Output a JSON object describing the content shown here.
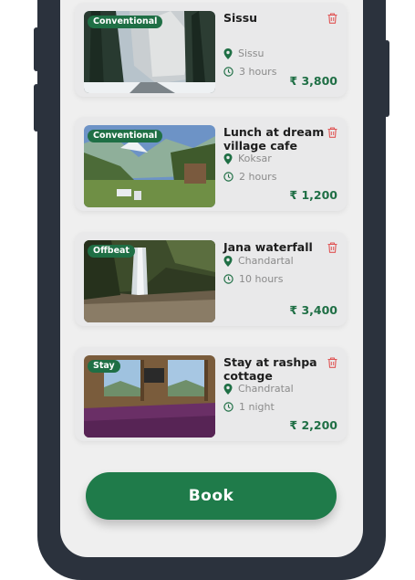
{
  "trips": [
    {
      "badge": "Conventional",
      "title": "Sissu",
      "location": "Sissu",
      "duration": "3 hours",
      "price": "₹ 3,800"
    },
    {
      "badge": "Conventional",
      "title": "Lunch at dream village cafe",
      "location": "Koksar",
      "duration": "2 hours",
      "price": "₹ 1,200"
    },
    {
      "badge": "Offbeat",
      "title": "Jana waterfall",
      "location": "Chandartal",
      "duration": "10 hours",
      "price": "₹ 3,400"
    },
    {
      "badge": "Stay",
      "title": "Stay at rashpa cottage",
      "location": "Chandratal",
      "duration": "1 night",
      "price": "₹ 2,200"
    }
  ],
  "book_button": {
    "label": "Book"
  },
  "icons": {
    "delete": "trash-icon",
    "location": "map-pin-icon",
    "duration": "clock-icon"
  },
  "colors": {
    "accent": "#1f6f45",
    "delete": "#e05555",
    "frame": "#2b323d",
    "screen": "#efefef"
  }
}
